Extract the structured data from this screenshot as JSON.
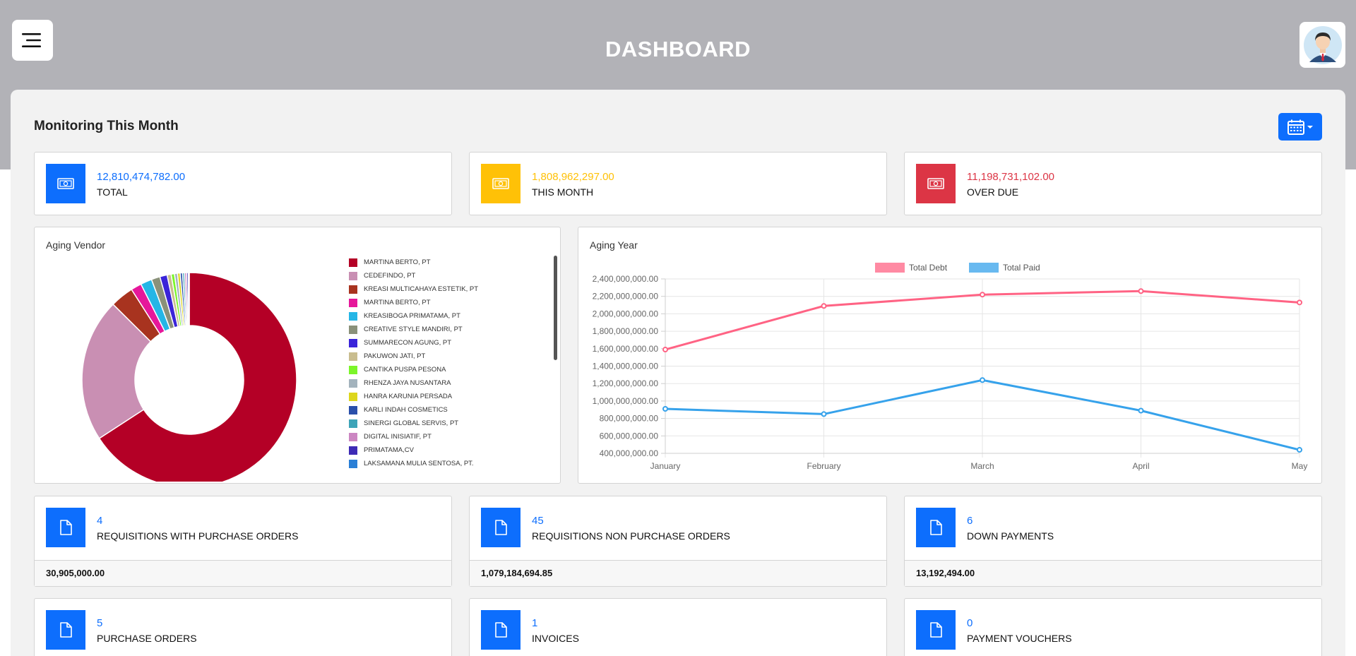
{
  "header": {
    "title": "DASHBOARD"
  },
  "monitoring": {
    "title": "Monitoring This Month"
  },
  "summary_cards": [
    {
      "value": "12,810,474,782.00",
      "label": "TOTAL",
      "color": "#0d6efd"
    },
    {
      "value": "1,808,962,297.00",
      "label": "THIS MONTH",
      "color": "#ffc107"
    },
    {
      "value": "11,198,731,102.00",
      "label": "OVER DUE",
      "color": "#dc3545"
    }
  ],
  "aging_vendor": {
    "title": "Aging Vendor",
    "legend": [
      {
        "name": "MARTINA BERTO, PT",
        "color": "#b40026"
      },
      {
        "name": "CEDEFINDO, PT",
        "color": "#c98fb3"
      },
      {
        "name": "KREASI MULTICAHAYA ESTETIK, PT",
        "color": "#a8331f"
      },
      {
        "name": "MARTINA BERTO, PT",
        "color": "#e6179a"
      },
      {
        "name": "KREASIBOGA PRIMATAMA, PT",
        "color": "#25b6e6"
      },
      {
        "name": "CREATIVE STYLE MANDIRI, PT",
        "color": "#8a917a"
      },
      {
        "name": "SUMMARECON AGUNG, PT",
        "color": "#3a24d9"
      },
      {
        "name": "PAKUWON JATI, PT",
        "color": "#c9bd8f"
      },
      {
        "name": "CANTIKA PUSPA PESONA",
        "color": "#7cf52a"
      },
      {
        "name": "RHENZA JAYA NUSANTARA",
        "color": "#a3b3bd"
      },
      {
        "name": "HANRA KARUNIA PERSADA",
        "color": "#ddd61c"
      },
      {
        "name": "KARLI INDAH COSMETICS",
        "color": "#2a4faa"
      },
      {
        "name": "SINERGI GLOBAL SERVIS, PT",
        "color": "#3ea4b8"
      },
      {
        "name": "DIGITAL INISIATIF, PT",
        "color": "#cc86c2"
      },
      {
        "name": "PRIMATAMA,CV",
        "color": "#3d2bb5"
      },
      {
        "name": "LAKSAMANA MULIA SENTOSA, PT.",
        "color": "#2a7fd6"
      }
    ]
  },
  "aging_year": {
    "title": "Aging Year"
  },
  "chart_data": [
    {
      "type": "pie",
      "title": "Aging Vendor",
      "categories": [
        "MARTINA BERTO, PT",
        "CEDEFINDO, PT",
        "KREASI MULTICAHAYA ESTETIK, PT",
        "MARTINA BERTO, PT",
        "KREASIBOGA PRIMATAMA, PT",
        "CREATIVE STYLE MANDIRI, PT",
        "SUMMARECON AGUNG, PT",
        "PAKUWON JATI, PT",
        "CANTIKA PUSPA PESONA",
        "RHENZA JAYA NUSANTARA",
        "HANRA KARUNIA PERSADA",
        "KARLI INDAH COSMETICS",
        "SINERGI GLOBAL SERVIS, PT",
        "DIGITAL INISIATIF, PT",
        "PRIMATAMA,CV",
        "LAKSAMANA MULIA SENTOSA, PT."
      ],
      "values": [
        65.5,
        21.5,
        3.5,
        1.6,
        1.7,
        1.3,
        1.1,
        0.6,
        0.5,
        0.45,
        0.4,
        0.35,
        0.3,
        0.3,
        0.25,
        0.15
      ],
      "donut": true
    },
    {
      "type": "line",
      "title": "Aging Year",
      "categories": [
        "January",
        "February",
        "March",
        "April",
        "May"
      ],
      "series": [
        {
          "name": "Total Debt",
          "color": "#ff6384",
          "values": [
            1590000000,
            2090000000,
            2220000000,
            2260000000,
            2130000000
          ]
        },
        {
          "name": "Total Paid",
          "color": "#36a2eb",
          "values": [
            910000000,
            850000000,
            1240000000,
            890000000,
            440000000
          ]
        }
      ],
      "ylim": [
        400000000,
        2400000000
      ],
      "yticks": [
        "2,400,000,000.00",
        "2,200,000,000.00",
        "2,000,000,000.00",
        "1,800,000,000.00",
        "1,600,000,000.00",
        "1,400,000,000.00",
        "1,200,000,000.00",
        "1,000,000,000.00",
        "800,000,000.00",
        "600,000,000.00",
        "400,000,000.00"
      ],
      "grid": true,
      "legend": "top"
    }
  ],
  "doc_cards": [
    {
      "count": "4",
      "label": "REQUISITIONS WITH PURCHASE ORDERS",
      "amount": "30,905,000.00"
    },
    {
      "count": "45",
      "label": "REQUISITIONS NON PURCHASE ORDERS",
      "amount": "1,079,184,694.85"
    },
    {
      "count": "6",
      "label": "DOWN PAYMENTS",
      "amount": "13,192,494.00"
    },
    {
      "count": "5",
      "label": "PURCHASE ORDERS"
    },
    {
      "count": "1",
      "label": "INVOICES"
    },
    {
      "count": "0",
      "label": "PAYMENT VOUCHERS"
    }
  ],
  "colors": {
    "primary": "#0d6efd",
    "header_bg": "#b2b2b7",
    "card_bg": "#f2f2f2"
  },
  "icons": {
    "menu": "hamburger-icon",
    "avatar": "user-avatar-icon",
    "calendar": "calendar-icon",
    "money": "money-bill-icon",
    "document": "file-icon"
  }
}
